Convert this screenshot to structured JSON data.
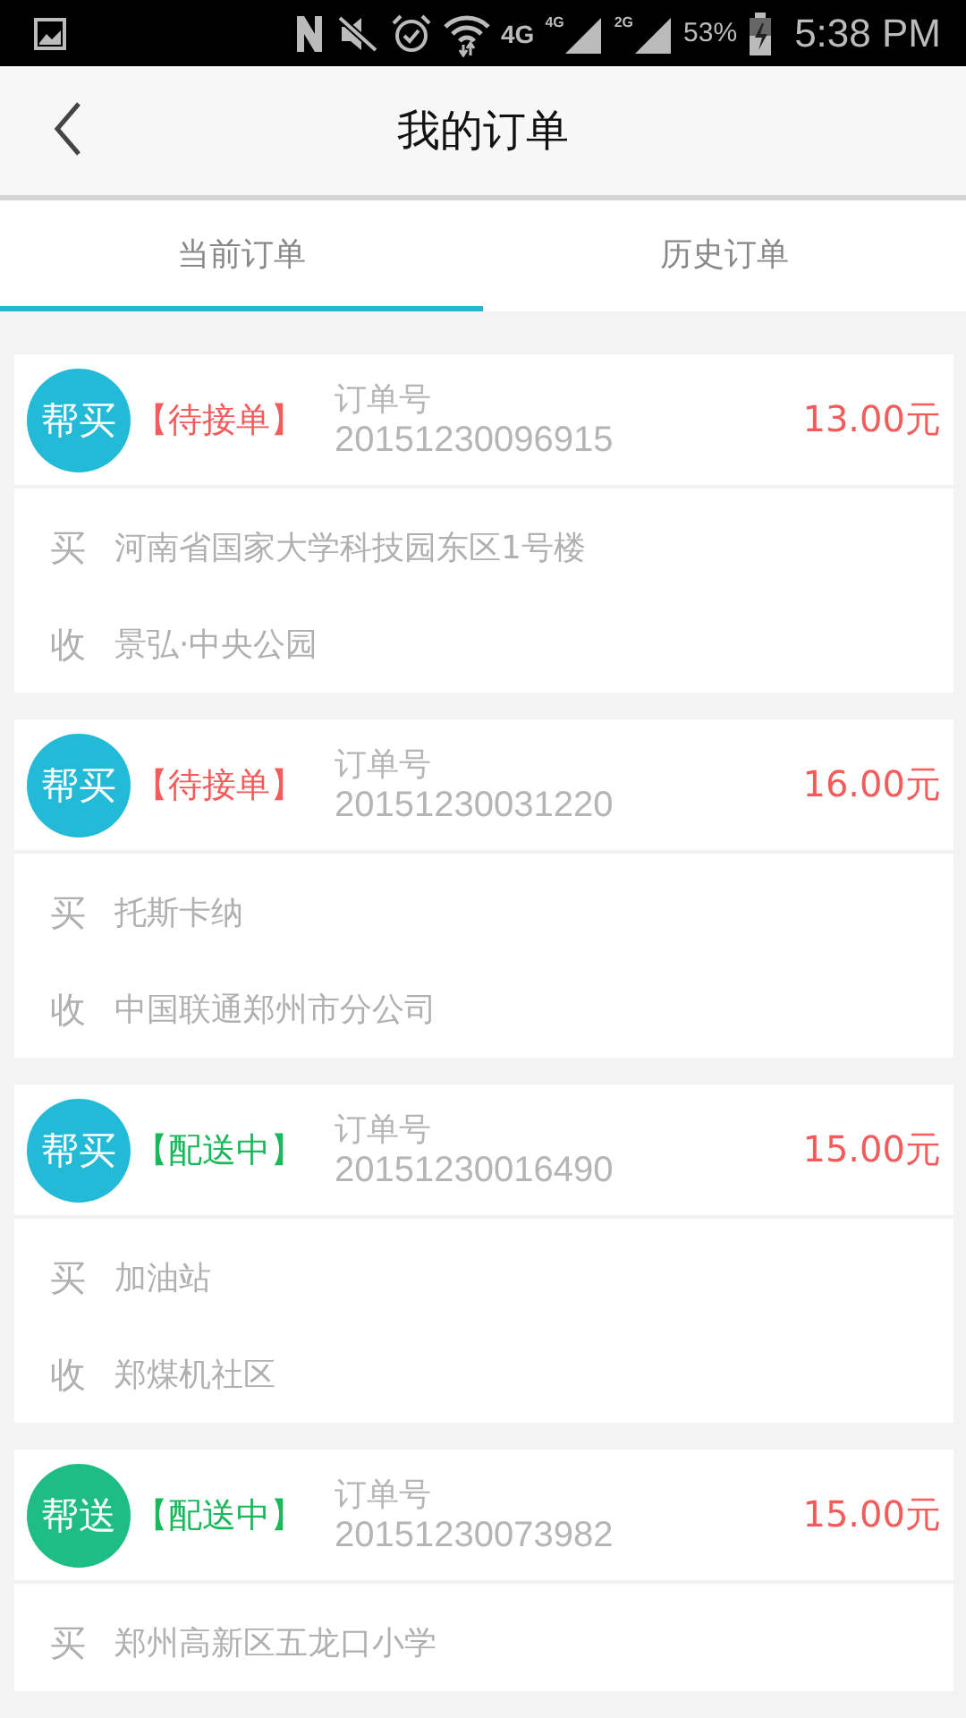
{
  "status_bar": {
    "network": "4G",
    "signal_1": "4G",
    "signal_2": "2G",
    "battery": "53%",
    "time": "5:38 PM"
  },
  "header": {
    "title": "我的订单"
  },
  "tabs": [
    {
      "label": "当前订单",
      "selected": true
    },
    {
      "label": "历史订单",
      "selected": false
    }
  ],
  "orders": [
    {
      "badge": {
        "text": "帮买",
        "kind": "buy"
      },
      "status": {
        "text": "【待接单】",
        "kind": "pending"
      },
      "number_label": "订单号",
      "number": "20151230096915",
      "price": "13.00元",
      "addresses": [
        {
          "label": "买",
          "text": "河南省国家大学科技园东区1号楼"
        },
        {
          "label": "收",
          "text": "景弘·中央公园"
        }
      ]
    },
    {
      "badge": {
        "text": "帮买",
        "kind": "buy"
      },
      "status": {
        "text": "【待接单】",
        "kind": "pending"
      },
      "number_label": "订单号",
      "number": "20151230031220",
      "price": "16.00元",
      "addresses": [
        {
          "label": "买",
          "text": "托斯卡纳"
        },
        {
          "label": "收",
          "text": "中国联通郑州市分公司"
        }
      ]
    },
    {
      "badge": {
        "text": "帮买",
        "kind": "buy"
      },
      "status": {
        "text": "【配送中】",
        "kind": "delivering"
      },
      "number_label": "订单号",
      "number": "20151230016490",
      "price": "15.00元",
      "addresses": [
        {
          "label": "买",
          "text": "加油站"
        },
        {
          "label": "收",
          "text": "郑煤机社区"
        }
      ]
    },
    {
      "badge": {
        "text": "帮送",
        "kind": "send"
      },
      "status": {
        "text": "【配送中】",
        "kind": "delivering"
      },
      "number_label": "订单号",
      "number": "20151230073982",
      "price": "15.00元",
      "addresses": [
        {
          "label": "买",
          "text": "郑州高新区五龙口小学"
        }
      ]
    }
  ]
}
